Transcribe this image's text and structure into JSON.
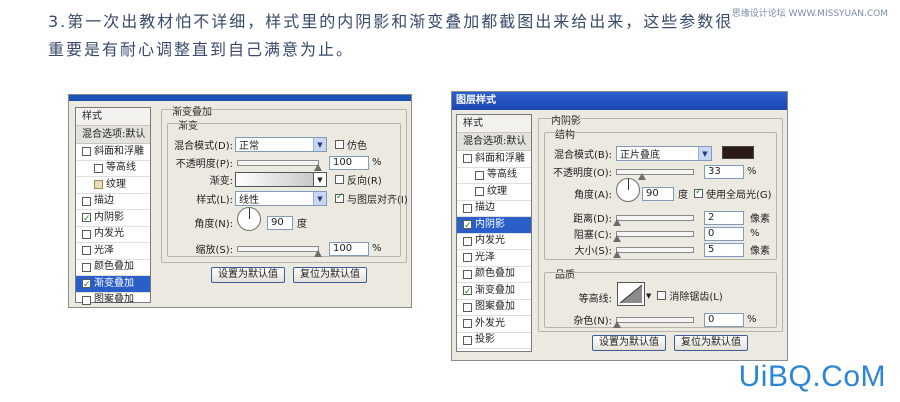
{
  "caption": {
    "line1": "3.第一次出教材怕不详细，样式里的内阴影和渐变叠加都截图出来给出来，这些参数很",
    "line2": "重要是有耐心调整直到自己满意为止。"
  },
  "watermarks": {
    "top": "思缘设计论坛 WWW.MISSYUAN.COM",
    "bottom": "UiBQ.CoM"
  },
  "left_dialog": {
    "sidebar": {
      "header": "样式",
      "blend": "混合选项:默认",
      "items": [
        {
          "label": "斜面和浮雕",
          "checked": false
        },
        {
          "label": "等高线",
          "checked": false
        },
        {
          "label": "纹理",
          "checked": false
        },
        {
          "label": "描边",
          "checked": false
        },
        {
          "label": "内阴影",
          "checked": true
        },
        {
          "label": "内发光",
          "checked": false
        },
        {
          "label": "光泽",
          "checked": false
        },
        {
          "label": "颜色叠加",
          "checked": false
        },
        {
          "label": "渐变叠加",
          "checked": true
        },
        {
          "label": "图案叠加",
          "checked": false
        }
      ]
    },
    "section_title": "渐变叠加",
    "group_title": "渐变",
    "blend_mode_label": "混合模式(D):",
    "blend_mode_value": "正常",
    "dither_label": "仿色",
    "opacity_label": "不透明度(P):",
    "opacity_value": "100",
    "opacity_unit": "%",
    "opacity_level": 100,
    "gradient_label": "渐变:",
    "reverse_label": "反向(R)",
    "style_label": "样式(L):",
    "style_value": "线性",
    "align_label": "与图层对齐(I)",
    "angle_label": "角度(N):",
    "angle_value": "90",
    "angle_unit": "度",
    "scale_label": "缩放(S):",
    "scale_value": "100",
    "scale_unit": "%",
    "scale_level": 100,
    "default_button": "设置为默认值",
    "reset_button": "复位为默认值"
  },
  "right_dialog": {
    "title": "图层样式",
    "sidebar": {
      "header": "样式",
      "blend": "混合选项:默认",
      "items": [
        {
          "label": "斜面和浮雕",
          "checked": false
        },
        {
          "label": "等高线",
          "checked": false
        },
        {
          "label": "纹理",
          "checked": false
        },
        {
          "label": "描边",
          "checked": false
        },
        {
          "label": "内阴影",
          "checked": true
        },
        {
          "label": "内发光",
          "checked": false
        },
        {
          "label": "光泽",
          "checked": false
        },
        {
          "label": "颜色叠加",
          "checked": false
        },
        {
          "label": "渐变叠加",
          "checked": true
        },
        {
          "label": "图案叠加",
          "checked": false
        },
        {
          "label": "外发光",
          "checked": false
        },
        {
          "label": "投影",
          "checked": false
        }
      ]
    },
    "section_title": "内阴影",
    "structure_title": "结构",
    "blend_mode_label": "混合模式(B):",
    "blend_mode_value": "正片叠底",
    "shadow_color": "#2a1a18",
    "opacity_label": "不透明度(O):",
    "opacity_value": "33",
    "opacity_unit": "%",
    "opacity_level": 33,
    "angle_label": "角度(A):",
    "angle_value": "90",
    "angle_unit": "度",
    "global_light_label": "使用全局光(G)",
    "distance_label": "距离(D):",
    "distance_value": "2",
    "distance_unit": "像素",
    "choke_label": "阻塞(C):",
    "choke_value": "0",
    "choke_unit": "%",
    "size_label": "大小(S):",
    "size_value": "5",
    "size_unit": "像素",
    "quality_title": "品质",
    "contour_label": "等高线:",
    "antialias_label": "消除锯齿(L)",
    "noise_label": "杂色(N):",
    "noise_value": "0",
    "noise_unit": "%",
    "default_button": "设置为默认值",
    "reset_button": "复位为默认值"
  }
}
